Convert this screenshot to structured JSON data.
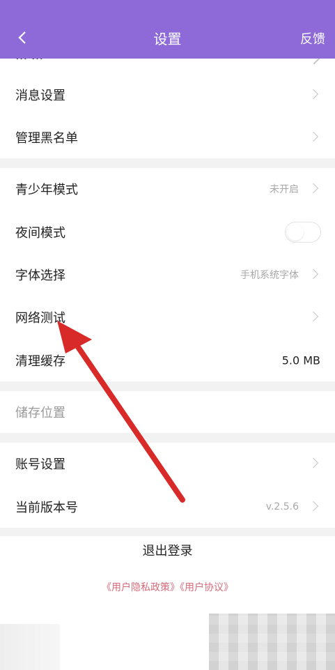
{
  "header": {
    "title": "设置",
    "feedback": "反馈",
    "back_icon": "chevron-left-icon"
  },
  "rows": {
    "message_settings": "消息设置",
    "blacklist": "管理黑名单",
    "youth_mode": {
      "label": "青少年模式",
      "value": "未开启"
    },
    "night_mode": {
      "label": "夜间模式",
      "enabled": false
    },
    "font": {
      "label": "字体选择",
      "value": "手机系统字体"
    },
    "network_test": "网络测试",
    "clear_cache": {
      "label": "清理缓存",
      "value": "5.0 MB"
    },
    "storage_location": "储存位置",
    "account_settings": "账号设置",
    "version": {
      "label": "当前版本号",
      "value": "v.2.5.6"
    }
  },
  "footer": {
    "logout": "退出登录",
    "policy_links": "《用户隐私政策》《用户协议》"
  },
  "colors": {
    "header_bg": "#8d6ad8",
    "policy_link": "#d86a7c",
    "annotation_arrow": "#d92a2a"
  }
}
